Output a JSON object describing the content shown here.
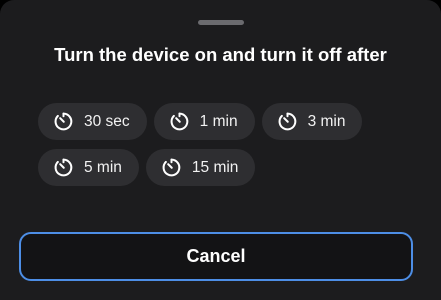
{
  "dialog": {
    "title": "Turn the device on and turn it off after"
  },
  "timer_options": [
    {
      "label": "30 sec",
      "icon": "timer-icon"
    },
    {
      "label": "1 min",
      "icon": "timer-icon"
    },
    {
      "label": "3 min",
      "icon": "timer-icon"
    },
    {
      "label": "5 min",
      "icon": "timer-icon"
    },
    {
      "label": "15 min",
      "icon": "timer-icon"
    }
  ],
  "actions": {
    "cancel_label": "Cancel"
  },
  "colors": {
    "background": "#1c1c1e",
    "chip_background": "#2e2e31",
    "accent_border": "#4d8ee6",
    "text": "#ffffff"
  }
}
